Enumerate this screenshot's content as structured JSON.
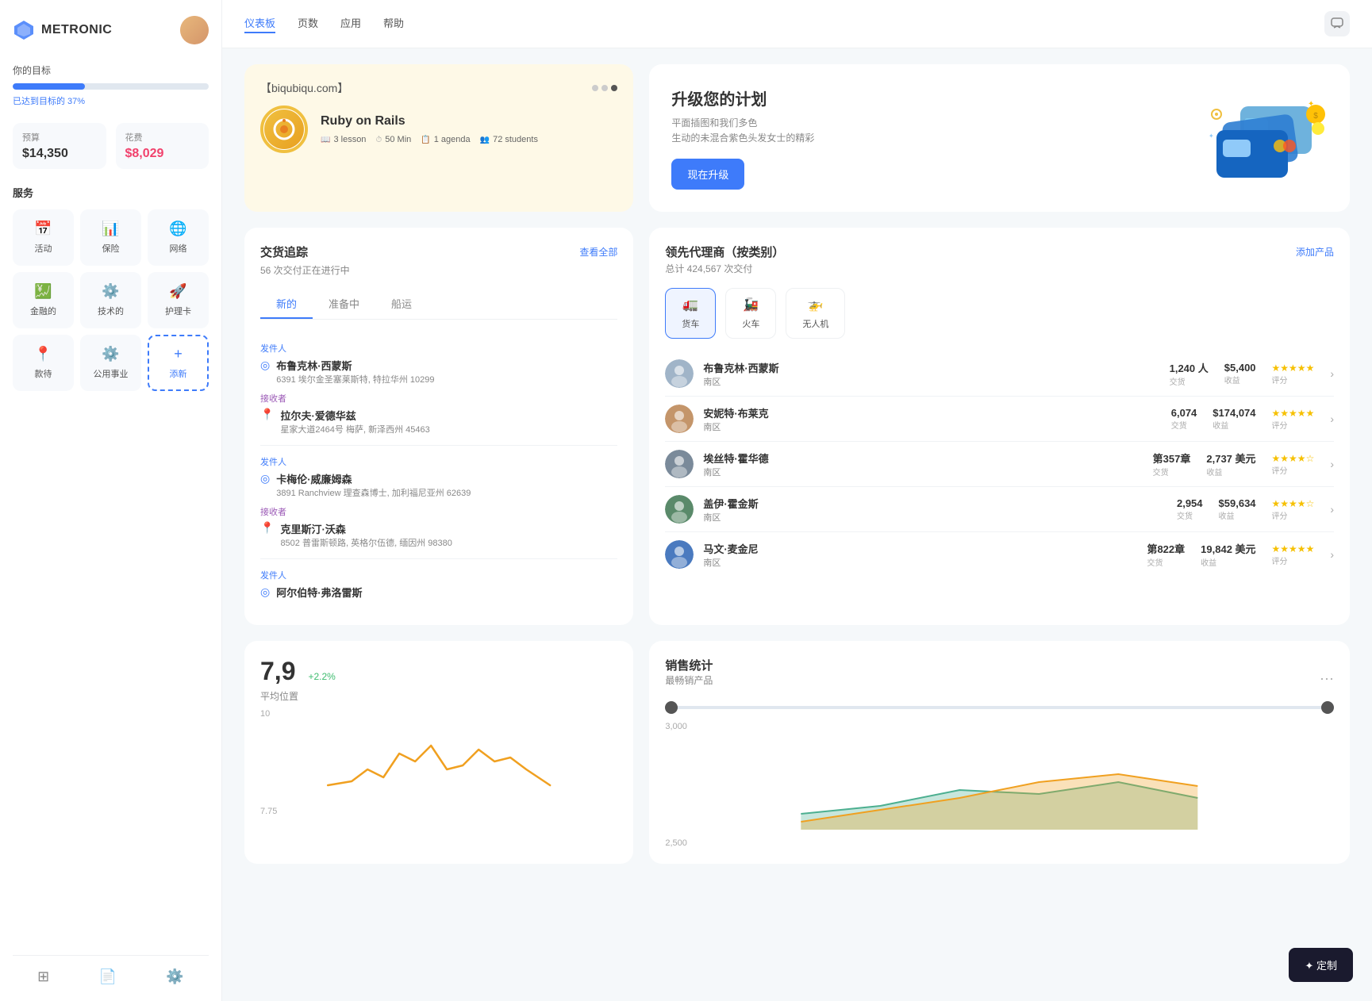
{
  "sidebar": {
    "brand": "METRONIC",
    "goal": {
      "label": "你的目标",
      "percent": 37,
      "percent_label": "已达到目标的 37%"
    },
    "budget": {
      "label": "预算",
      "value": "$14,350",
      "expense_label": "花费",
      "expense_value": "$8,029"
    },
    "services": {
      "label": "服务",
      "items": [
        {
          "name": "活动",
          "icon": "📅"
        },
        {
          "name": "保险",
          "icon": "📊"
        },
        {
          "name": "网络",
          "icon": "🌐"
        },
        {
          "name": "金融的",
          "icon": "💹"
        },
        {
          "name": "技术的",
          "icon": "⚙️"
        },
        {
          "name": "护理卡",
          "icon": "🚀"
        },
        {
          "name": "款待",
          "icon": "📍"
        },
        {
          "name": "公用事业",
          "icon": "⚙️"
        },
        {
          "name": "添新",
          "icon": "+",
          "add": true
        }
      ]
    },
    "bottom_icons": [
      "layers-icon",
      "file-icon",
      "settings-icon"
    ]
  },
  "topnav": {
    "links": [
      {
        "label": "仪表板",
        "active": true
      },
      {
        "label": "页数",
        "active": false
      },
      {
        "label": "应用",
        "active": false
      },
      {
        "label": "帮助",
        "active": false
      }
    ]
  },
  "course_card": {
    "url": "【biqubiqu.com】",
    "title": "Ruby on Rails",
    "meta": [
      {
        "icon": "📖",
        "value": "3 lesson"
      },
      {
        "icon": "⏱",
        "value": "50 Min"
      },
      {
        "icon": "📋",
        "value": "1 agenda"
      },
      {
        "icon": "👥",
        "value": "72 students"
      }
    ]
  },
  "upgrade_card": {
    "title": "升级您的计划",
    "desc_line1": "平面插图和我们多色",
    "desc_line2": "生动的未混合紫色头发女士的精彩",
    "btn_label": "现在升级"
  },
  "shipment": {
    "title": "交货追踪",
    "subtitle": "56 次交付正在进行中",
    "link": "查看全部",
    "tabs": [
      "新的",
      "准备中",
      "船运"
    ],
    "active_tab": 0,
    "items": [
      {
        "sender_label": "发件人",
        "sender_name": "布鲁克林·西蒙斯",
        "sender_address": "6391 埃尔金圣塞莱斯特, 特拉华州 10299",
        "receiver_label": "接收者",
        "receiver_name": "拉尔夫·爱德华兹",
        "receiver_address": "星家大道2464号 梅萨, 新泽西州 45463"
      },
      {
        "sender_label": "发件人",
        "sender_name": "卡梅伦·威廉姆森",
        "sender_address": "3891 Ranchview 理查森博士, 加利福尼亚州 62639",
        "receiver_label": "接收者",
        "receiver_name": "克里斯汀·沃森",
        "receiver_address": "8502 普雷斯顿路, 英格尔伍德, 缅因州 98380"
      },
      {
        "sender_label": "发件人",
        "sender_name": "阿尔伯特·弗洛雷斯",
        "sender_address": "",
        "receiver_label": "",
        "receiver_name": "",
        "receiver_address": ""
      }
    ]
  },
  "agents": {
    "title": "领先代理商（按类别）",
    "subtitle": "总计 424,567 次交付",
    "add_btn": "添加产品",
    "categories": [
      {
        "label": "货车",
        "icon": "🚛",
        "active": true
      },
      {
        "label": "火车",
        "icon": "🚂",
        "active": false
      },
      {
        "label": "无人机",
        "icon": "🚁",
        "active": false
      }
    ],
    "agents": [
      {
        "name": "布鲁克林·西蒙斯",
        "region": "南区",
        "transactions": "1,240 人",
        "transactions_label": "交货",
        "revenue": "$5,400",
        "revenue_label": "收益",
        "stars": 5,
        "rating_label": "评分",
        "avatar_color": "#a0b4c8"
      },
      {
        "name": "安妮特·布莱克",
        "region": "南区",
        "transactions": "6,074",
        "transactions_label": "交货",
        "revenue": "$174,074",
        "revenue_label": "收益",
        "stars": 5,
        "rating_label": "评分",
        "avatar_color": "#c4956a"
      },
      {
        "name": "埃丝特·霍华德",
        "region": "南区",
        "transactions": "第357章",
        "transactions_label": "交货",
        "revenue": "2,737 美元",
        "revenue_label": "收益",
        "stars": 4,
        "rating_label": "评分",
        "avatar_color": "#7a8a9a"
      },
      {
        "name": "盖伊·霍金斯",
        "region": "南区",
        "transactions": "2,954",
        "transactions_label": "交货",
        "revenue": "$59,634",
        "revenue_label": "收益",
        "stars": 4,
        "rating_label": "评分",
        "avatar_color": "#5a8a6a"
      },
      {
        "name": "马文·麦金尼",
        "region": "南区",
        "transactions": "第822章",
        "transactions_label": "交货",
        "revenue": "19,842 美元",
        "revenue_label": "收益",
        "stars": 5,
        "rating_label": "评分",
        "avatar_color": "#4a7abf"
      }
    ]
  },
  "avg_position": {
    "value": "7,9",
    "trend": "+2.2%",
    "label": "平均位置",
    "chart_label_10": "10",
    "chart_label_775": "7.75"
  },
  "sales_stats": {
    "title": "销售统计",
    "subtitle": "最畅销产品"
  },
  "customize": {
    "label": "✦ 定制"
  }
}
